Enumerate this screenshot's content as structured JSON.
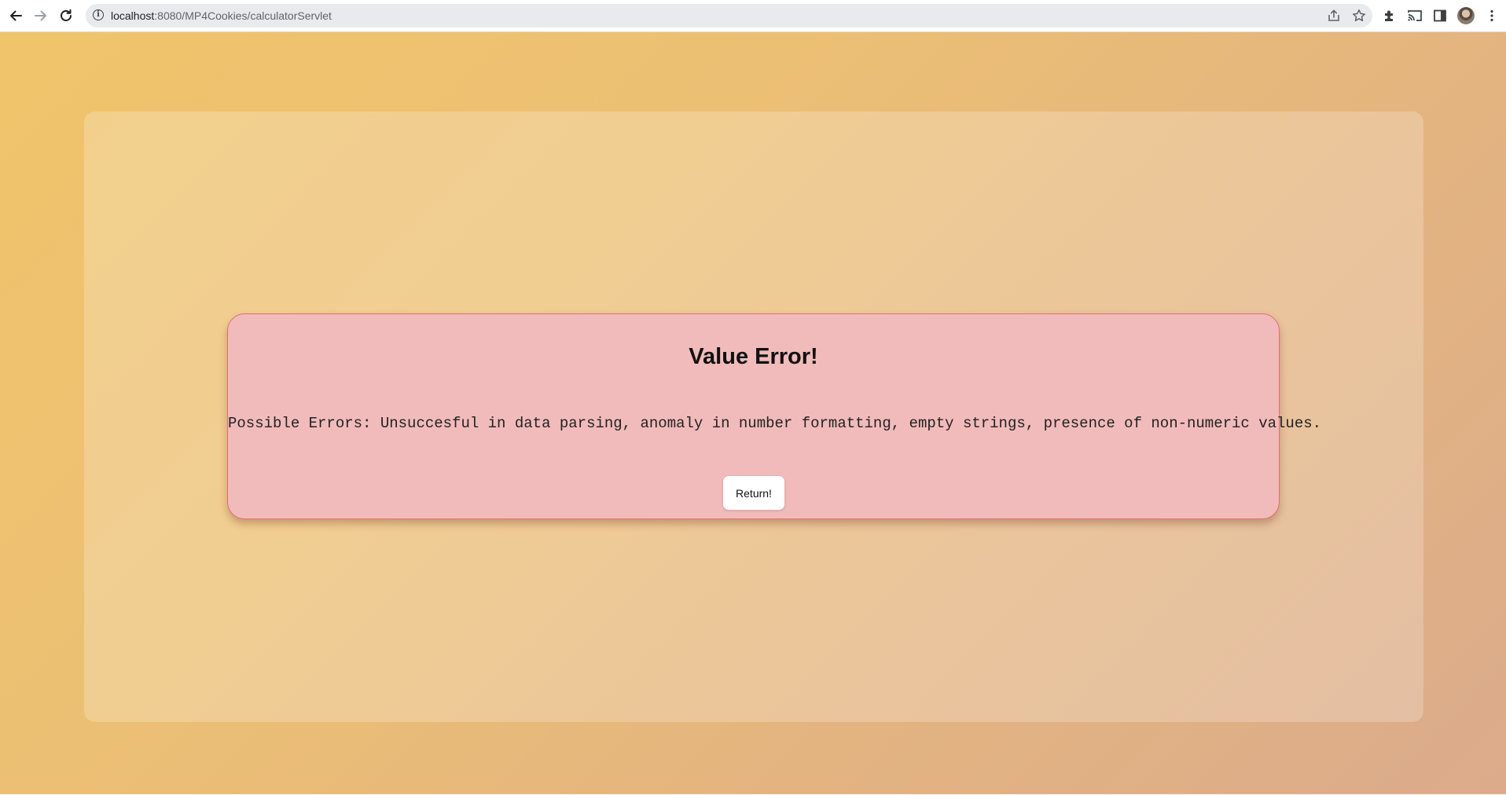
{
  "browser": {
    "url_host": "localhost",
    "url_rest": ":8080/MP4Cookies/calculatorServlet",
    "icons": {
      "back": "back-arrow-icon",
      "forward": "forward-arrow-icon",
      "reload": "reload-icon",
      "info": "info-icon",
      "share": "share-icon",
      "bookmark": "star-icon",
      "extensions": "puzzle-icon",
      "cast": "cast-icon",
      "side_panel": "side-panel-icon",
      "profile": "avatar",
      "menu": "kebab-menu-icon"
    }
  },
  "page": {
    "background_colors": [
      "#f0c46a",
      "#dbab8c"
    ],
    "error_card": {
      "title": "Value Error!",
      "message": "Possible Errors: Unsuccesful in data parsing, anomaly in number formatting, empty strings, presence of non-numeric values.",
      "button_label": "Return!",
      "background_color": "#f2bbbb",
      "border_color": "#e07070"
    }
  }
}
